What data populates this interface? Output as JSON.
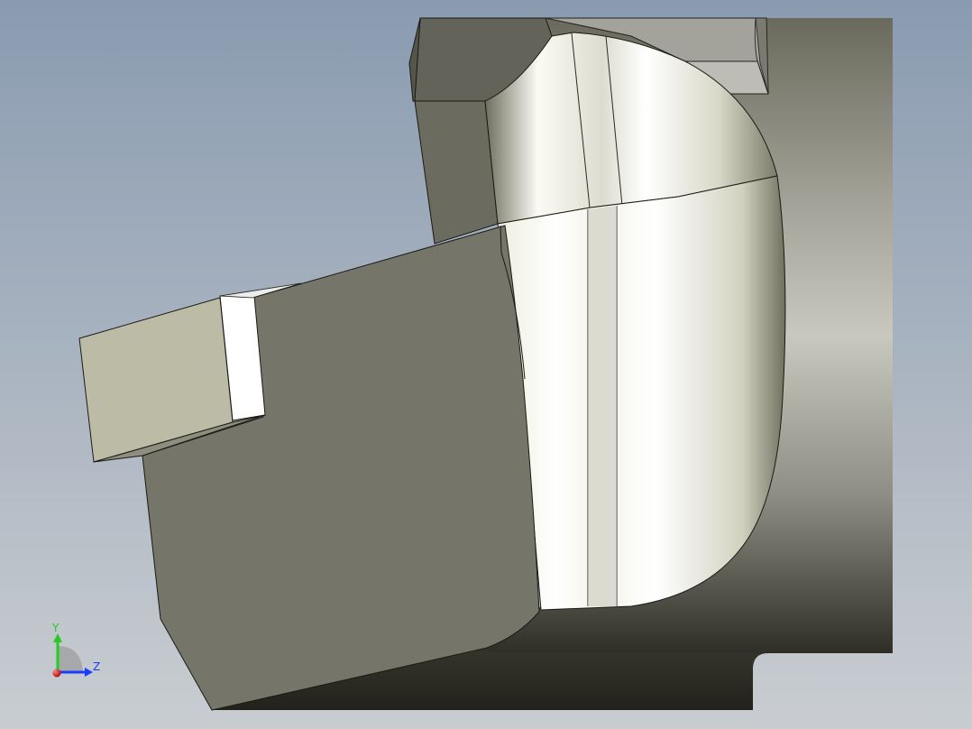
{
  "viewport": {
    "background_top": "#8a9bb0",
    "background_bottom": "#c8ccd0"
  },
  "triad": {
    "y_label": "Y",
    "z_label": "Z",
    "y_color": "#22cc22",
    "z_color": "#1a3cff",
    "x_color": "#dd1111"
  }
}
